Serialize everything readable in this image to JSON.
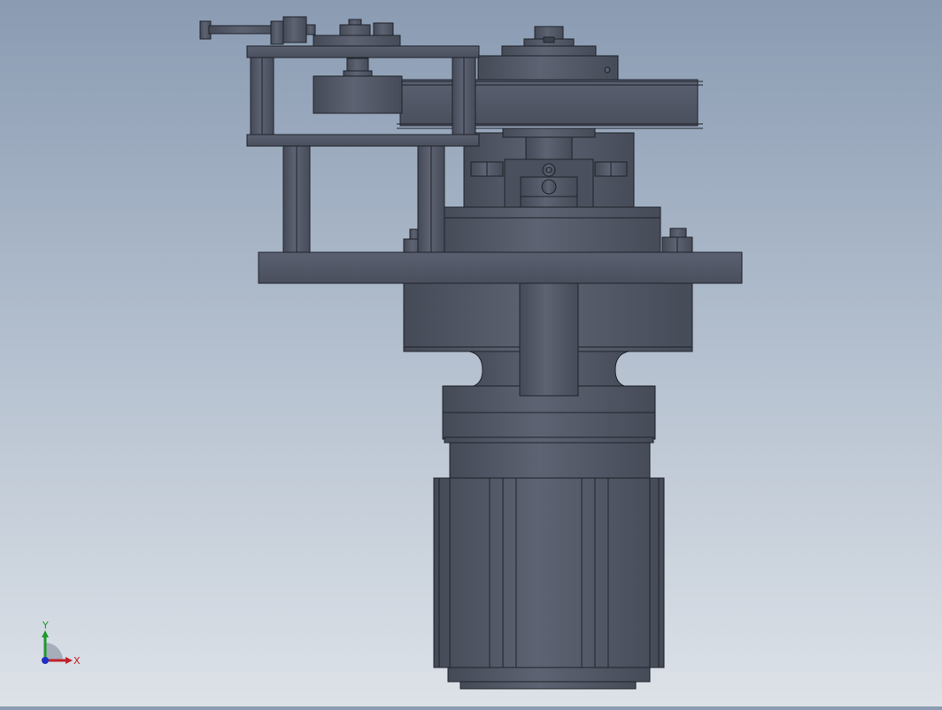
{
  "viewport": {
    "body_color": "#4f5564",
    "edge_color": "#1f232b",
    "dark_color": "#3c414c",
    "light_color": "#6a7080"
  },
  "triad": {
    "x_label": "X",
    "y_label": "Y",
    "x_color": "#c0202a",
    "y_color": "#1f9a2e",
    "z_color": "#1f2fbf"
  }
}
